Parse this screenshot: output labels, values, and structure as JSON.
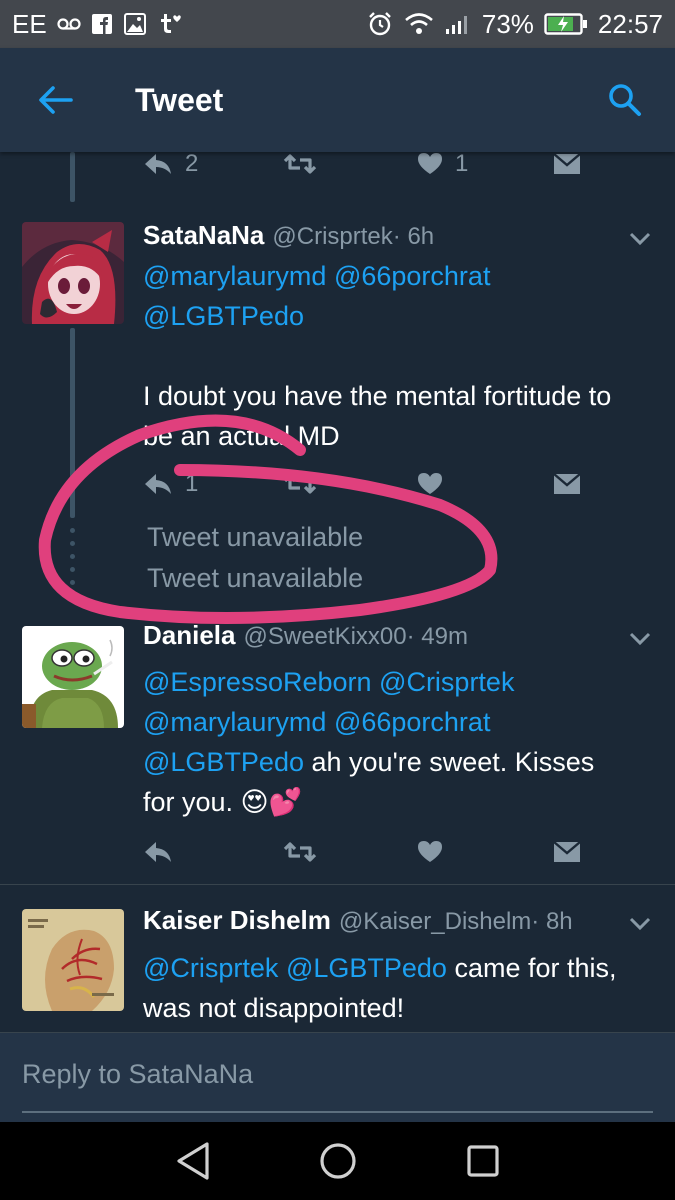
{
  "status_bar": {
    "carrier": "EE",
    "battery": "73%",
    "time": "22:57"
  },
  "header": {
    "title": "Tweet"
  },
  "prev_actions": {
    "reply_count": "2",
    "like_count": "1"
  },
  "tweets": [
    {
      "name": "SataNaNa",
      "handle": "@Crisprtek",
      "time": " · 6h",
      "mentions": [
        "@marylaurymd",
        "@66porchrat",
        "@LGBTPedo"
      ],
      "text": "I doubt you have the mental fortitude to be an actual MD",
      "reply_count": "1"
    },
    {
      "name": "Daniela",
      "handle": "@SweetKixx00",
      "time": " · 49m",
      "mentions": [
        "@EspressoReborn",
        "@Crisprtek",
        "@marylaurymd",
        "@66porchrat",
        "@LGBTPedo"
      ],
      "text_a": " ah you're sweet. Kisses",
      "text_b": "for you. ",
      "emoji": "😍💕"
    },
    {
      "name": "Kaiser Dishelm",
      "handle": "@Kaiser_Dishelm",
      "time": " · 8h",
      "mentions": [
        "@Crisprtek",
        "@LGBTPedo"
      ],
      "text_a": " came for this,",
      "text_b": "was not disappointed!"
    }
  ],
  "unavailable": [
    "Tweet unavailable",
    "Tweet unavailable"
  ],
  "reply_box": {
    "placeholder": "Reply to SataNaNa"
  },
  "colors": {
    "accent": "#1da1f2",
    "annotation": "#e0407d",
    "background": "#1b2836",
    "header": "#243447"
  }
}
